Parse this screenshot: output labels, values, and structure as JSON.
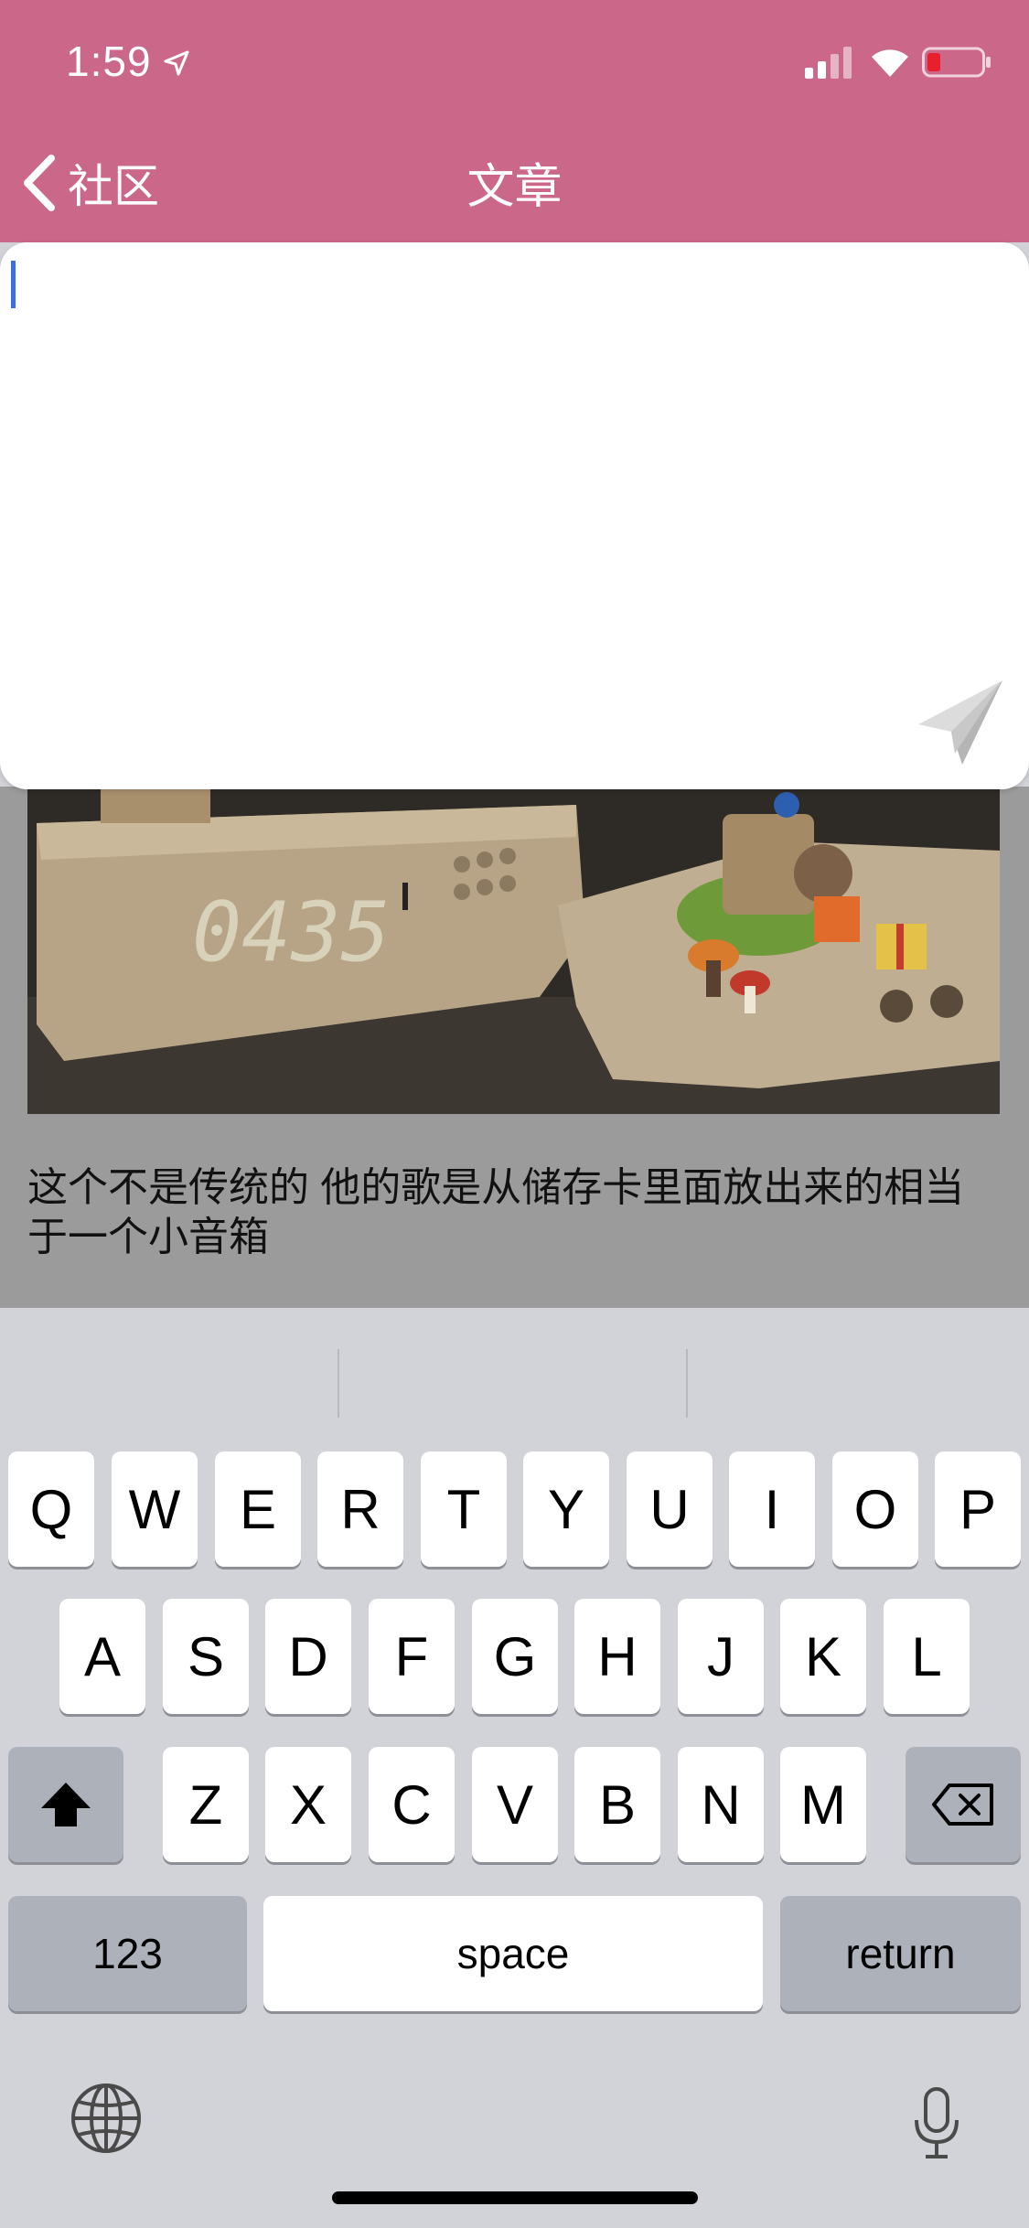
{
  "status_bar": {
    "time": "1:59"
  },
  "nav": {
    "back_label": "社区",
    "title": "文章"
  },
  "composer": {
    "text": ""
  },
  "article": {
    "text": "这个不是传统的 他的歌是从储存卡里面放出来的相当于一个小音箱"
  },
  "photo": {
    "clock_display": "0435"
  },
  "keyboard": {
    "row1": [
      "Q",
      "W",
      "E",
      "R",
      "T",
      "Y",
      "U",
      "I",
      "O",
      "P"
    ],
    "row2": [
      "A",
      "S",
      "D",
      "F",
      "G",
      "H",
      "J",
      "K",
      "L"
    ],
    "row3": [
      "Z",
      "X",
      "C",
      "V",
      "B",
      "N",
      "M"
    ],
    "numbers_label": "123",
    "space_label": "space",
    "return_label": "return"
  },
  "colors": {
    "header": "#cb6789",
    "cursor": "#3b6fe0",
    "keyboard_bg": "#d1d3d9"
  }
}
